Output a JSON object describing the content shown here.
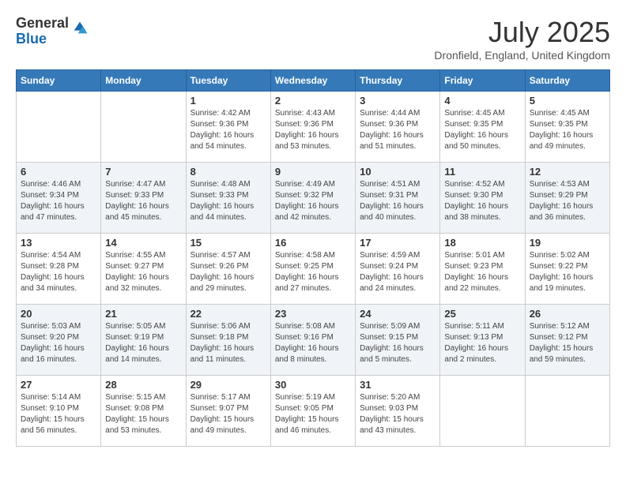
{
  "logo": {
    "general": "General",
    "blue": "Blue"
  },
  "title": "July 2025",
  "subtitle": "Dronfield, England, United Kingdom",
  "days_of_week": [
    "Sunday",
    "Monday",
    "Tuesday",
    "Wednesday",
    "Thursday",
    "Friday",
    "Saturday"
  ],
  "weeks": [
    [
      {
        "day": "",
        "sunrise": "",
        "sunset": "",
        "daylight": ""
      },
      {
        "day": "",
        "sunrise": "",
        "sunset": "",
        "daylight": ""
      },
      {
        "day": "1",
        "sunrise": "Sunrise: 4:42 AM",
        "sunset": "Sunset: 9:36 PM",
        "daylight": "Daylight: 16 hours and 54 minutes."
      },
      {
        "day": "2",
        "sunrise": "Sunrise: 4:43 AM",
        "sunset": "Sunset: 9:36 PM",
        "daylight": "Daylight: 16 hours and 53 minutes."
      },
      {
        "day": "3",
        "sunrise": "Sunrise: 4:44 AM",
        "sunset": "Sunset: 9:36 PM",
        "daylight": "Daylight: 16 hours and 51 minutes."
      },
      {
        "day": "4",
        "sunrise": "Sunrise: 4:45 AM",
        "sunset": "Sunset: 9:35 PM",
        "daylight": "Daylight: 16 hours and 50 minutes."
      },
      {
        "day": "5",
        "sunrise": "Sunrise: 4:45 AM",
        "sunset": "Sunset: 9:35 PM",
        "daylight": "Daylight: 16 hours and 49 minutes."
      }
    ],
    [
      {
        "day": "6",
        "sunrise": "Sunrise: 4:46 AM",
        "sunset": "Sunset: 9:34 PM",
        "daylight": "Daylight: 16 hours and 47 minutes."
      },
      {
        "day": "7",
        "sunrise": "Sunrise: 4:47 AM",
        "sunset": "Sunset: 9:33 PM",
        "daylight": "Daylight: 16 hours and 45 minutes."
      },
      {
        "day": "8",
        "sunrise": "Sunrise: 4:48 AM",
        "sunset": "Sunset: 9:33 PM",
        "daylight": "Daylight: 16 hours and 44 minutes."
      },
      {
        "day": "9",
        "sunrise": "Sunrise: 4:49 AM",
        "sunset": "Sunset: 9:32 PM",
        "daylight": "Daylight: 16 hours and 42 minutes."
      },
      {
        "day": "10",
        "sunrise": "Sunrise: 4:51 AM",
        "sunset": "Sunset: 9:31 PM",
        "daylight": "Daylight: 16 hours and 40 minutes."
      },
      {
        "day": "11",
        "sunrise": "Sunrise: 4:52 AM",
        "sunset": "Sunset: 9:30 PM",
        "daylight": "Daylight: 16 hours and 38 minutes."
      },
      {
        "day": "12",
        "sunrise": "Sunrise: 4:53 AM",
        "sunset": "Sunset: 9:29 PM",
        "daylight": "Daylight: 16 hours and 36 minutes."
      }
    ],
    [
      {
        "day": "13",
        "sunrise": "Sunrise: 4:54 AM",
        "sunset": "Sunset: 9:28 PM",
        "daylight": "Daylight: 16 hours and 34 minutes."
      },
      {
        "day": "14",
        "sunrise": "Sunrise: 4:55 AM",
        "sunset": "Sunset: 9:27 PM",
        "daylight": "Daylight: 16 hours and 32 minutes."
      },
      {
        "day": "15",
        "sunrise": "Sunrise: 4:57 AM",
        "sunset": "Sunset: 9:26 PM",
        "daylight": "Daylight: 16 hours and 29 minutes."
      },
      {
        "day": "16",
        "sunrise": "Sunrise: 4:58 AM",
        "sunset": "Sunset: 9:25 PM",
        "daylight": "Daylight: 16 hours and 27 minutes."
      },
      {
        "day": "17",
        "sunrise": "Sunrise: 4:59 AM",
        "sunset": "Sunset: 9:24 PM",
        "daylight": "Daylight: 16 hours and 24 minutes."
      },
      {
        "day": "18",
        "sunrise": "Sunrise: 5:01 AM",
        "sunset": "Sunset: 9:23 PM",
        "daylight": "Daylight: 16 hours and 22 minutes."
      },
      {
        "day": "19",
        "sunrise": "Sunrise: 5:02 AM",
        "sunset": "Sunset: 9:22 PM",
        "daylight": "Daylight: 16 hours and 19 minutes."
      }
    ],
    [
      {
        "day": "20",
        "sunrise": "Sunrise: 5:03 AM",
        "sunset": "Sunset: 9:20 PM",
        "daylight": "Daylight: 16 hours and 16 minutes."
      },
      {
        "day": "21",
        "sunrise": "Sunrise: 5:05 AM",
        "sunset": "Sunset: 9:19 PM",
        "daylight": "Daylight: 16 hours and 14 minutes."
      },
      {
        "day": "22",
        "sunrise": "Sunrise: 5:06 AM",
        "sunset": "Sunset: 9:18 PM",
        "daylight": "Daylight: 16 hours and 11 minutes."
      },
      {
        "day": "23",
        "sunrise": "Sunrise: 5:08 AM",
        "sunset": "Sunset: 9:16 PM",
        "daylight": "Daylight: 16 hours and 8 minutes."
      },
      {
        "day": "24",
        "sunrise": "Sunrise: 5:09 AM",
        "sunset": "Sunset: 9:15 PM",
        "daylight": "Daylight: 16 hours and 5 minutes."
      },
      {
        "day": "25",
        "sunrise": "Sunrise: 5:11 AM",
        "sunset": "Sunset: 9:13 PM",
        "daylight": "Daylight: 16 hours and 2 minutes."
      },
      {
        "day": "26",
        "sunrise": "Sunrise: 5:12 AM",
        "sunset": "Sunset: 9:12 PM",
        "daylight": "Daylight: 15 hours and 59 minutes."
      }
    ],
    [
      {
        "day": "27",
        "sunrise": "Sunrise: 5:14 AM",
        "sunset": "Sunset: 9:10 PM",
        "daylight": "Daylight: 15 hours and 56 minutes."
      },
      {
        "day": "28",
        "sunrise": "Sunrise: 5:15 AM",
        "sunset": "Sunset: 9:08 PM",
        "daylight": "Daylight: 15 hours and 53 minutes."
      },
      {
        "day": "29",
        "sunrise": "Sunrise: 5:17 AM",
        "sunset": "Sunset: 9:07 PM",
        "daylight": "Daylight: 15 hours and 49 minutes."
      },
      {
        "day": "30",
        "sunrise": "Sunrise: 5:19 AM",
        "sunset": "Sunset: 9:05 PM",
        "daylight": "Daylight: 15 hours and 46 minutes."
      },
      {
        "day": "31",
        "sunrise": "Sunrise: 5:20 AM",
        "sunset": "Sunset: 9:03 PM",
        "daylight": "Daylight: 15 hours and 43 minutes."
      },
      {
        "day": "",
        "sunrise": "",
        "sunset": "",
        "daylight": ""
      },
      {
        "day": "",
        "sunrise": "",
        "sunset": "",
        "daylight": ""
      }
    ]
  ]
}
